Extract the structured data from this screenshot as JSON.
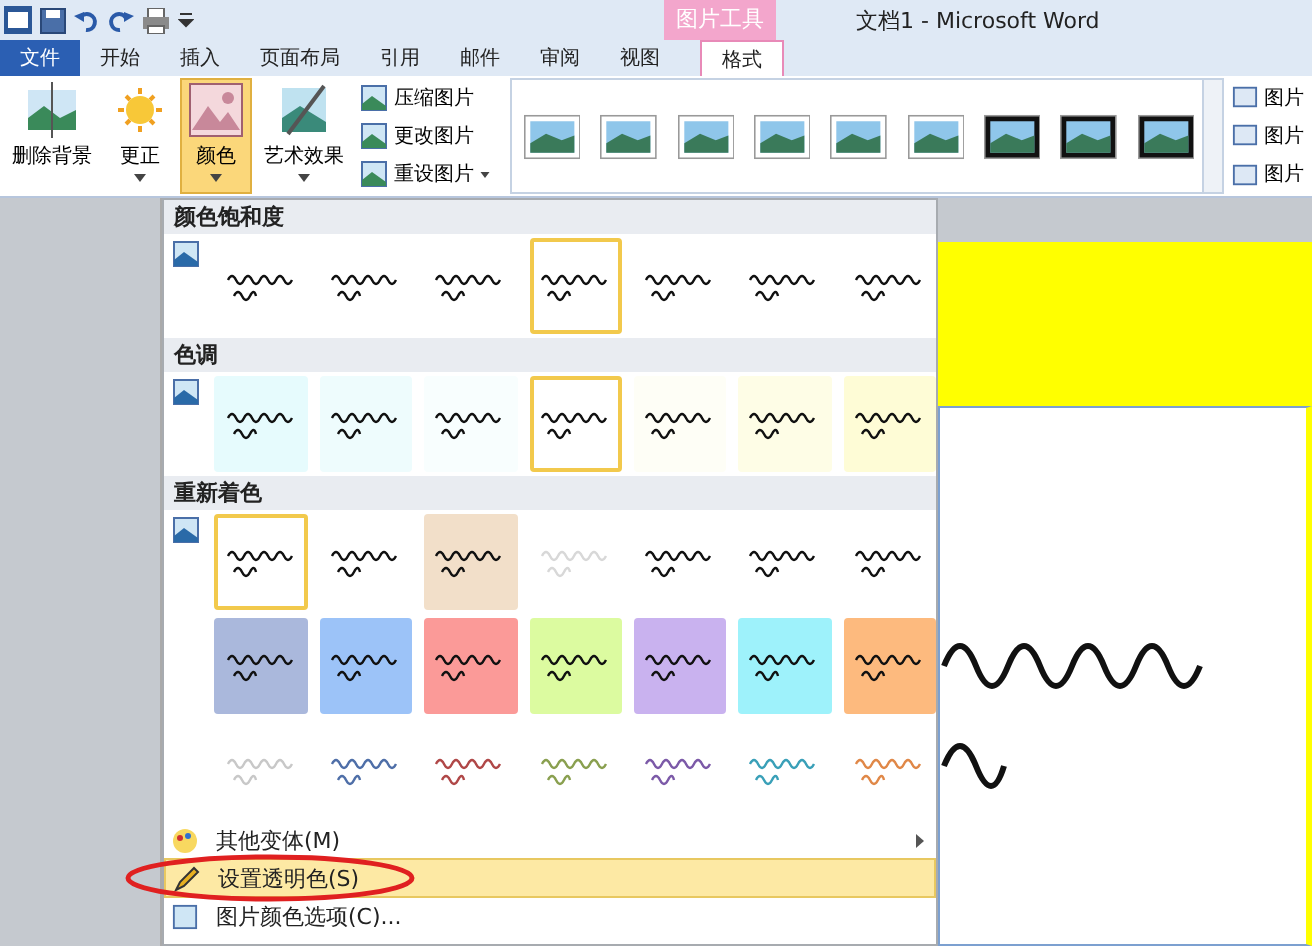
{
  "window": {
    "title": "文档1  -  Microsoft Word",
    "context_tab": "图片工具"
  },
  "tabs": [
    {
      "label": "文件",
      "kind": "file",
      "selected": false
    },
    {
      "label": "开始",
      "kind": "tab",
      "selected": false
    },
    {
      "label": "插入",
      "kind": "tab",
      "selected": false
    },
    {
      "label": "页面布局",
      "kind": "tab",
      "selected": false
    },
    {
      "label": "引用",
      "kind": "tab",
      "selected": false
    },
    {
      "label": "邮件",
      "kind": "tab",
      "selected": false
    },
    {
      "label": "审阅",
      "kind": "tab",
      "selected": false
    },
    {
      "label": "视图",
      "kind": "tab",
      "selected": false
    },
    {
      "label": "格式",
      "kind": "context",
      "selected": true
    }
  ],
  "ribbon": {
    "large_buttons": [
      {
        "label": "删除背景",
        "selected": false,
        "dropdown": false
      },
      {
        "label": "更正",
        "selected": false,
        "dropdown": true
      },
      {
        "label": "颜色",
        "selected": true,
        "dropdown": true
      },
      {
        "label": "艺术效果",
        "selected": false,
        "dropdown": true
      }
    ],
    "small_buttons": [
      {
        "label": "压缩图片",
        "dropdown": false
      },
      {
        "label": "更改图片",
        "dropdown": false
      },
      {
        "label": "重设图片",
        "dropdown": true
      }
    ],
    "right_buttons": [
      "图片",
      "图片",
      "图片"
    ]
  },
  "menu": {
    "sections": [
      {
        "title": "颜色饱和度",
        "rows": [
          [
            {
              "kind": "fill",
              "color": "#ffffff",
              "selected": false
            },
            {
              "kind": "fill",
              "color": "#ffffff",
              "selected": false
            },
            {
              "kind": "fill",
              "color": "#ffffff",
              "selected": false
            },
            {
              "kind": "fill",
              "color": "#ffffff",
              "selected": true
            },
            {
              "kind": "fill",
              "color": "#ffffff",
              "selected": false
            },
            {
              "kind": "fill",
              "color": "#ffffff",
              "selected": false
            },
            {
              "kind": "fill",
              "color": "#ffffff",
              "selected": false
            }
          ]
        ]
      },
      {
        "title": "色调",
        "rows": [
          [
            {
              "kind": "fill",
              "color": "#e6fbfd",
              "selected": false
            },
            {
              "kind": "fill",
              "color": "#eefcfd",
              "selected": false
            },
            {
              "kind": "fill",
              "color": "#f8fefe",
              "selected": false
            },
            {
              "kind": "fill",
              "color": "#ffffff",
              "selected": true
            },
            {
              "kind": "fill",
              "color": "#fefef6",
              "selected": false
            },
            {
              "kind": "fill",
              "color": "#fefde6",
              "selected": false
            },
            {
              "kind": "fill",
              "color": "#fefcd6",
              "selected": false
            }
          ]
        ]
      },
      {
        "title": "重新着色",
        "rows": [
          [
            {
              "kind": "fill",
              "color": "#ffffff",
              "selected": true
            },
            {
              "kind": "fill",
              "color": "#ffffff",
              "selected": false
            },
            {
              "kind": "fill",
              "color": "#f2dfc9",
              "selected": false
            },
            {
              "kind": "ink",
              "color": "#d8d8d8",
              "selected": false
            },
            {
              "kind": "fill",
              "color": "#ffffff",
              "selected": false
            },
            {
              "kind": "fill",
              "color": "#ffffff",
              "selected": false
            },
            {
              "kind": "fill",
              "color": "#ffffff",
              "selected": false
            }
          ],
          [
            {
              "kind": "fill",
              "color": "#aab8dc",
              "selected": false
            },
            {
              "kind": "fill",
              "color": "#9cc3f8",
              "selected": false
            },
            {
              "kind": "fill",
              "color": "#fb9a98",
              "selected": false
            },
            {
              "kind": "fill",
              "color": "#dcfba0",
              "selected": false
            },
            {
              "kind": "fill",
              "color": "#c9b2ef",
              "selected": false
            },
            {
              "kind": "fill",
              "color": "#9ef2fb",
              "selected": false
            },
            {
              "kind": "fill",
              "color": "#fdba7e",
              "selected": false
            }
          ],
          [
            {
              "kind": "ink",
              "color": "#c8c8c8",
              "selected": false
            },
            {
              "kind": "ink",
              "color": "#4f6fa8",
              "selected": false
            },
            {
              "kind": "ink",
              "color": "#b04848",
              "selected": false
            },
            {
              "kind": "ink",
              "color": "#8aa050",
              "selected": false
            },
            {
              "kind": "ink",
              "color": "#7c5aa8",
              "selected": false
            },
            {
              "kind": "ink",
              "color": "#3aa0b8",
              "selected": false
            },
            {
              "kind": "ink",
              "color": "#e08848",
              "selected": false
            }
          ]
        ]
      }
    ],
    "items": [
      {
        "label": "其他变体(M)",
        "submenu": true,
        "selected": false
      },
      {
        "label": "设置透明色(S)",
        "submenu": false,
        "selected": true
      },
      {
        "label": "图片颜色选项(C)...",
        "submenu": false,
        "selected": false
      }
    ]
  }
}
